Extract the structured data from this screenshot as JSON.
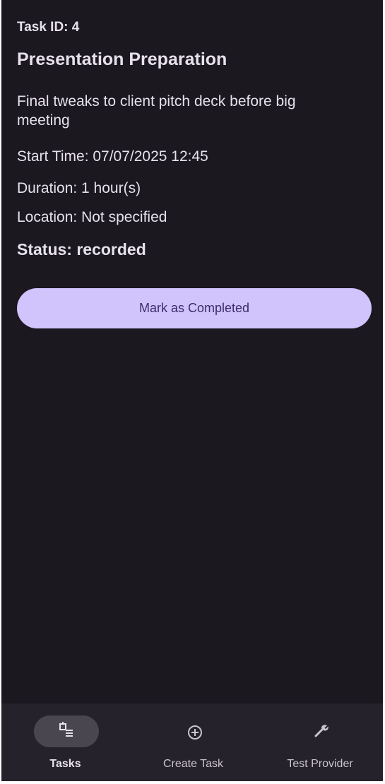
{
  "task": {
    "id_label": "Task ID: 4",
    "title": "Presentation Preparation",
    "description": "Final tweaks to client pitch deck before big meeting",
    "start_time": "Start Time: 07/07/2025 12:45",
    "duration": "Duration: 1 hour(s)",
    "location": "Location: Not specified",
    "status": "Status: recorded"
  },
  "actions": {
    "mark_completed_label": "Mark as Completed"
  },
  "nav": {
    "items": [
      {
        "label": "Tasks",
        "icon": "tasks-icon",
        "selected": true
      },
      {
        "label": "Create Task",
        "icon": "add-circle-icon",
        "selected": false
      },
      {
        "label": "Test Provider",
        "icon": "wrench-icon",
        "selected": false
      }
    ]
  },
  "colors": {
    "background": "#1b1820",
    "nav_background": "#25222b",
    "button": "#d1c3fb",
    "button_text": "#3b2d6d",
    "text": "#e6e1ea"
  }
}
